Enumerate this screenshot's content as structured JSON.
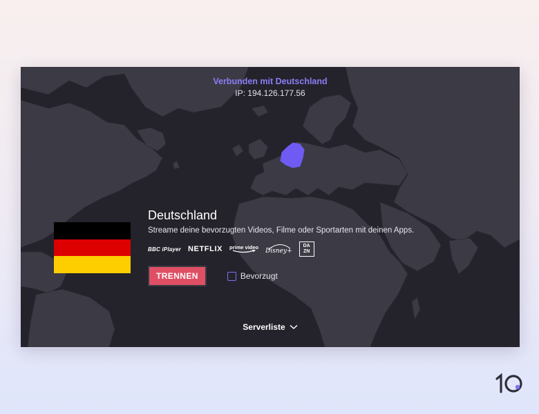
{
  "status": {
    "connected_text": "Verbunden mit Deutschland",
    "ip_text": "IP: 194.126.177.56",
    "accent_color": "#8b7df5"
  },
  "location": {
    "country": "Deutschland",
    "description": "Streame deine bevorzugten Videos, Filme oder Sportarten mit deinen Apps.",
    "flag_colors": [
      "#000000",
      "#dd0000",
      "#ffce00"
    ]
  },
  "streaming_logos": {
    "bbc": "BBC iPlayer",
    "netflix": "NETFLIX",
    "prime_line1": "prime video",
    "disney": "Disney+",
    "dazn_line1": "DA",
    "dazn_line2": "ZN"
  },
  "actions": {
    "disconnect_label": "TRENNEN",
    "disconnect_color": "#df4f64",
    "favorite_label": "Bevorzugt",
    "favorite_checked": false
  },
  "footer": {
    "serverlist_label": "Serverliste",
    "serverlist_icon": "chevron-down-icon"
  },
  "brand": {
    "logo_text": "10",
    "logo_icon": "top10vpn-logo"
  }
}
